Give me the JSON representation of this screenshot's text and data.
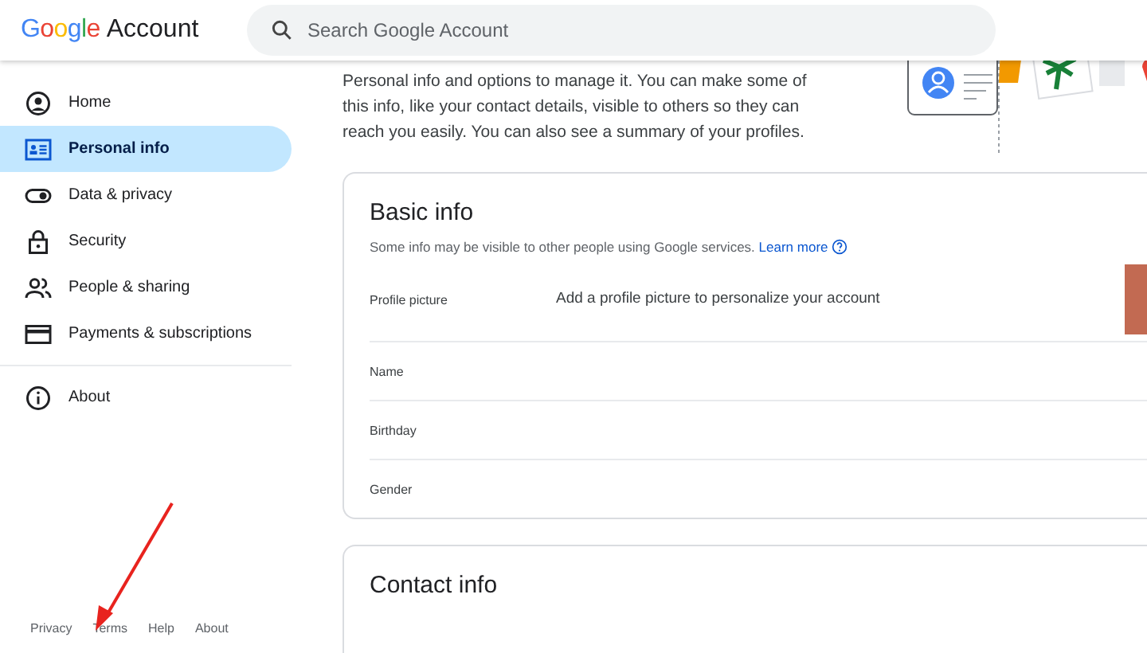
{
  "header": {
    "logo": "Google",
    "product": "Account",
    "search": {
      "placeholder": "Search Google Account"
    }
  },
  "sidebar": {
    "items": [
      {
        "label": "Home",
        "kind": "home",
        "selected": false
      },
      {
        "label": "Personal info",
        "kind": "personal",
        "selected": true
      },
      {
        "label": "Data & privacy",
        "kind": "toggle",
        "selected": false
      },
      {
        "label": "Security",
        "kind": "lock",
        "selected": false
      },
      {
        "label": "People & sharing",
        "kind": "people",
        "selected": false
      },
      {
        "label": "Payments & subscriptions",
        "kind": "card",
        "selected": false
      }
    ],
    "secondary_items": [
      {
        "label": "About",
        "kind": "info",
        "selected": false
      }
    ],
    "footer_links": [
      "Privacy",
      "Terms",
      "Help",
      "About"
    ]
  },
  "intro": "Personal info and options to manage it. You can make some of this info, like your contact details, visible to others so they can reach you easily. You can also see a summary of your profiles.",
  "basic_info": {
    "title": "Basic info",
    "subtitle": "Some info may be visible to other people using Google services.",
    "link": "Learn more",
    "rows": [
      {
        "label": "Profile picture",
        "value": "Add a profile picture to personalize your account"
      },
      {
        "label": "Name"
      },
      {
        "label": "Birthday"
      },
      {
        "label": "Gender"
      }
    ]
  },
  "contact_info": {
    "title": "Contact info"
  }
}
